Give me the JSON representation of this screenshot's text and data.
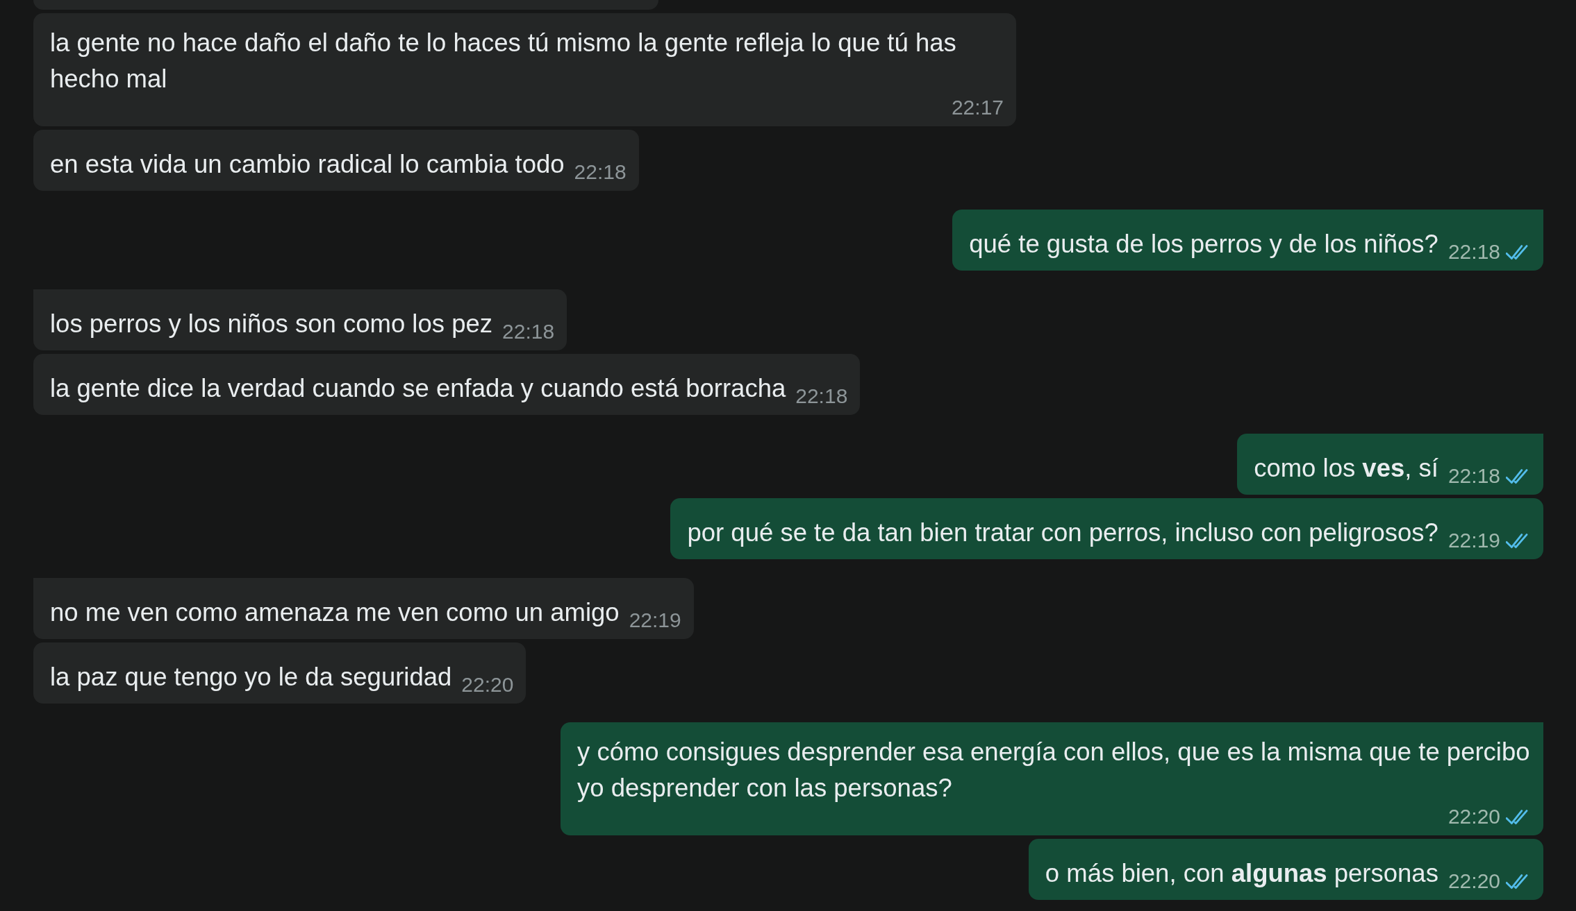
{
  "messages": [
    {
      "kind": "clipped",
      "tail": false
    },
    {
      "kind": "incoming",
      "tail": false,
      "text": "la gente no hace daño el daño te lo haces tú mismo la gente refleja lo que tú has hecho mal",
      "time": "22:17"
    },
    {
      "kind": "incoming",
      "tail": false,
      "text": "en esta vida un cambio radical lo cambia todo",
      "time": "22:18"
    },
    {
      "kind": "outgoing",
      "tail": true,
      "text": "qué te gusta de los perros y de los niños?",
      "time": "22:18",
      "read": true
    },
    {
      "kind": "incoming",
      "tail": true,
      "text": "los perros y los niños son como los pez",
      "time": "22:18"
    },
    {
      "kind": "incoming",
      "tail": false,
      "text": "la gente dice la verdad cuando se enfada y cuando está borracha",
      "time": "22:18"
    },
    {
      "kind": "outgoing",
      "tail": true,
      "text": "como los **ves**, sí",
      "time": "22:18",
      "read": true
    },
    {
      "kind": "outgoing",
      "tail": false,
      "text": "por qué se te da tan bien tratar con perros, incluso con peligrosos?",
      "time": "22:19",
      "read": true
    },
    {
      "kind": "incoming",
      "tail": true,
      "text": "no me ven como amenaza me ven como un amigo",
      "time": "22:19"
    },
    {
      "kind": "incoming",
      "tail": false,
      "text": "la paz que tengo yo le da seguridad",
      "time": "22:20"
    },
    {
      "kind": "outgoing",
      "tail": true,
      "text": "y cómo consigues desprender esa energía con ellos, que es la misma que te percibo yo desprender con las personas?",
      "time": "22:20",
      "read": true
    },
    {
      "kind": "outgoing",
      "tail": false,
      "text": "o más bien, con **algunas** personas",
      "time": "22:20",
      "read": true
    }
  ]
}
